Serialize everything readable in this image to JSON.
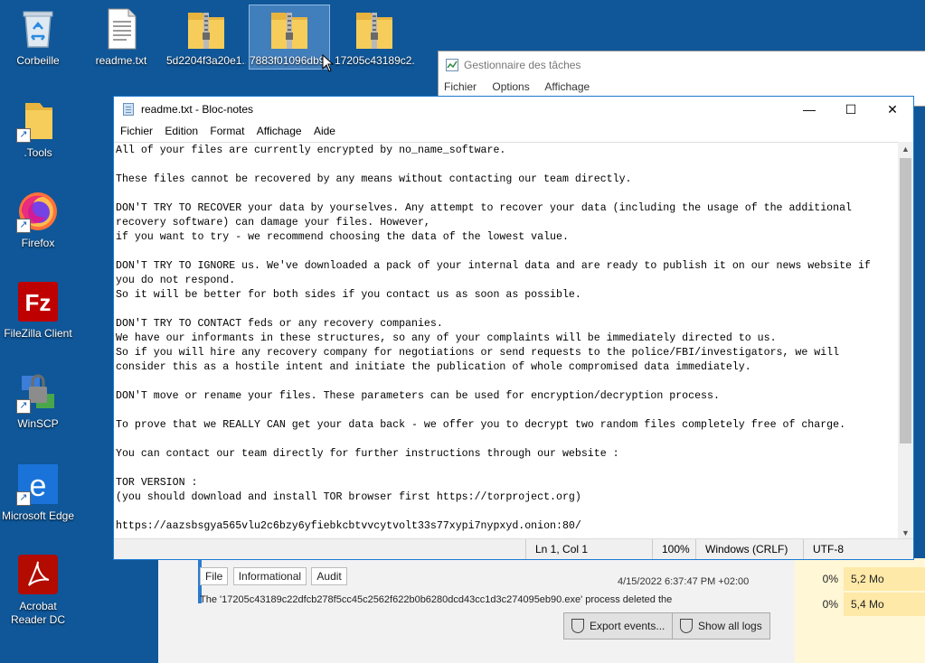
{
  "desktop": {
    "icons": [
      {
        "label": "Corbeille",
        "icon": "recycle-bin-icon"
      },
      {
        "label": "readme.txt",
        "icon": "text-file-icon"
      },
      {
        "label": "5d2204f3a20e1...",
        "icon": "zip-folder-icon"
      },
      {
        "label": "7883f01096db9...",
        "icon": "zip-folder-icon"
      },
      {
        "label": "17205c43189c2...",
        "icon": "zip-folder-icon"
      },
      {
        "label": ".Tools",
        "icon": "folder-icon"
      },
      {
        "label": "Firefox",
        "icon": "firefox-icon"
      },
      {
        "label": "FileZilla Client",
        "icon": "filezilla-icon"
      },
      {
        "label": "WinSCP",
        "icon": "winscp-icon"
      },
      {
        "label": "Microsoft Edge",
        "icon": "edge-icon"
      },
      {
        "label": "Acrobat Reader DC",
        "icon": "acrobat-icon"
      }
    ]
  },
  "taskmgr": {
    "title": "Gestionnaire des tâches",
    "menu": [
      "Fichier",
      "Options",
      "Affichage"
    ]
  },
  "events": {
    "badges": [
      "File",
      "Informational",
      "Audit"
    ],
    "time": "4/15/2022 6:37:47 PM +02:00",
    "message": "The '17205c43189c22dfcb278f5cc45c2562f622b0b6280dcd43cc1d3c274095eb90.exe' process deleted the",
    "export_label": "Export events...",
    "logs_label": "Show all logs"
  },
  "right_panel": {
    "rows": [
      {
        "pct": "0%",
        "mem": "5,2 Mo"
      },
      {
        "pct": "0%",
        "mem": "5,4 Mo"
      }
    ]
  },
  "notepad": {
    "title": "readme.txt - Bloc-notes",
    "menu": [
      "Fichier",
      "Edition",
      "Format",
      "Affichage",
      "Aide"
    ],
    "content": "All of your files are currently encrypted by no_name_software.\n\nThese files cannot be recovered by any means without contacting our team directly.\n\nDON'T TRY TO RECOVER your data by yourselves. Any attempt to recover your data (including the usage of the additional\nrecovery software) can damage your files. However,\nif you want to try - we recommend choosing the data of the lowest value.\n\nDON'T TRY TO IGNORE us. We've downloaded a pack of your internal data and are ready to publish it on our news website if\nyou do not respond.\nSo it will be better for both sides if you contact us as soon as possible.\n\nDON'T TRY TO CONTACT feds or any recovery companies.\nWe have our informants in these structures, so any of your complaints will be immediately directed to us.\nSo if you will hire any recovery company for negotiations or send requests to the police/FBI/investigators, we will\nconsider this as a hostile intent and initiate the publication of whole compromised data immediately.\n\nDON'T move or rename your files. These parameters can be used for encryption/decryption process.\n\nTo prove that we REALLY CAN get your data back - we offer you to decrypt two random files completely free of charge.\n\nYou can contact our team directly for further instructions through our website :\n\nTOR VERSION :\n(you should download and install TOR browser first https://torproject.org)\n\nhttps://aazsbsgya565vlu2c6bzy6yfiebkcbtvvcytvolt33s77xypi7nypxyd.onion:80/",
    "status": {
      "position": "Ln 1, Col 1",
      "zoom": "100%",
      "eol": "Windows (CRLF)",
      "encoding": "UTF-8"
    }
  }
}
